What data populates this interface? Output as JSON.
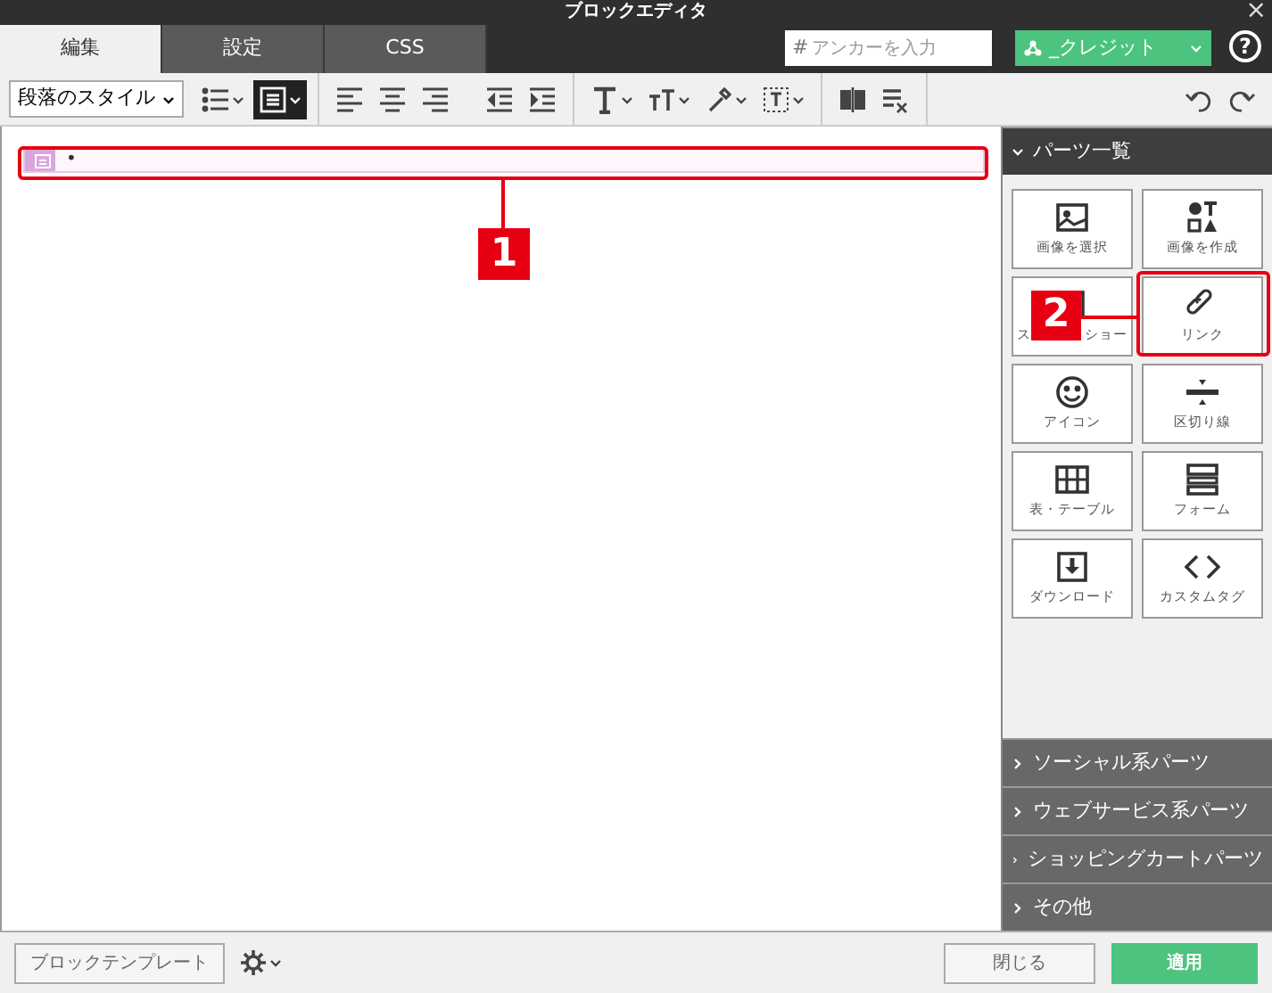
{
  "window": {
    "title": "ブロックエディタ",
    "close": "×"
  },
  "tabs": [
    {
      "label": "編集",
      "selected": true
    },
    {
      "label": "設定",
      "selected": false
    },
    {
      "label": "CSS",
      "selected": false
    }
  ],
  "anchor": {
    "prefix": "#",
    "placeholder": "アンカーを入力"
  },
  "credit": {
    "label": "_クレジット"
  },
  "help": "?",
  "toolbar": {
    "style_select": "段落のスタイル",
    "buttons": [
      {
        "kind": "list",
        "selected": false
      },
      {
        "kind": "paragraph",
        "selected": true
      },
      {
        "kind": "align-left",
        "selected": false
      },
      {
        "kind": "align-center",
        "selected": false
      },
      {
        "kind": "align-right",
        "selected": false
      },
      {
        "kind": "outdent",
        "selected": false
      },
      {
        "kind": "indent",
        "selected": false
      },
      {
        "kind": "font",
        "selected": false
      },
      {
        "kind": "size",
        "selected": false
      },
      {
        "kind": "color",
        "selected": false
      },
      {
        "kind": "box",
        "selected": false
      },
      {
        "kind": "split",
        "selected": false
      },
      {
        "kind": "clear",
        "selected": false
      }
    ]
  },
  "editor": {
    "block": {
      "text": "•"
    }
  },
  "sidebar": {
    "sections": [
      {
        "title": "パーツ一覧",
        "expanded": true,
        "parts": [
          {
            "kind": "image",
            "label": "画像を選択"
          },
          {
            "kind": "shapes",
            "label": "画像を作成"
          },
          {
            "kind": "slideshow",
            "label_start": "ス",
            "label": "ショー"
          },
          {
            "kind": "link",
            "label": "リンク"
          },
          {
            "kind": "smile",
            "label": "アイコン"
          },
          {
            "kind": "divider",
            "label": "区切り線"
          },
          {
            "kind": "table",
            "label": "表・テーブル"
          },
          {
            "kind": "form",
            "label": "フォーム"
          },
          {
            "kind": "download",
            "label": "ダウンロード"
          },
          {
            "kind": "code",
            "label": "カスタムタグ"
          }
        ]
      },
      {
        "title": "ソーシャル系パーツ",
        "expanded": false
      },
      {
        "title": "ウェブサービス系パーツ",
        "expanded": false
      },
      {
        "title": "ショッピングカートパーツ",
        "expanded": false
      },
      {
        "title": "その他",
        "expanded": false
      }
    ]
  },
  "footer": {
    "template_button": "ブロックテンプレート",
    "close_button": "閉じる",
    "apply_button": "適用"
  },
  "callouts": [
    {
      "label": "1"
    },
    {
      "label": "2"
    }
  ]
}
